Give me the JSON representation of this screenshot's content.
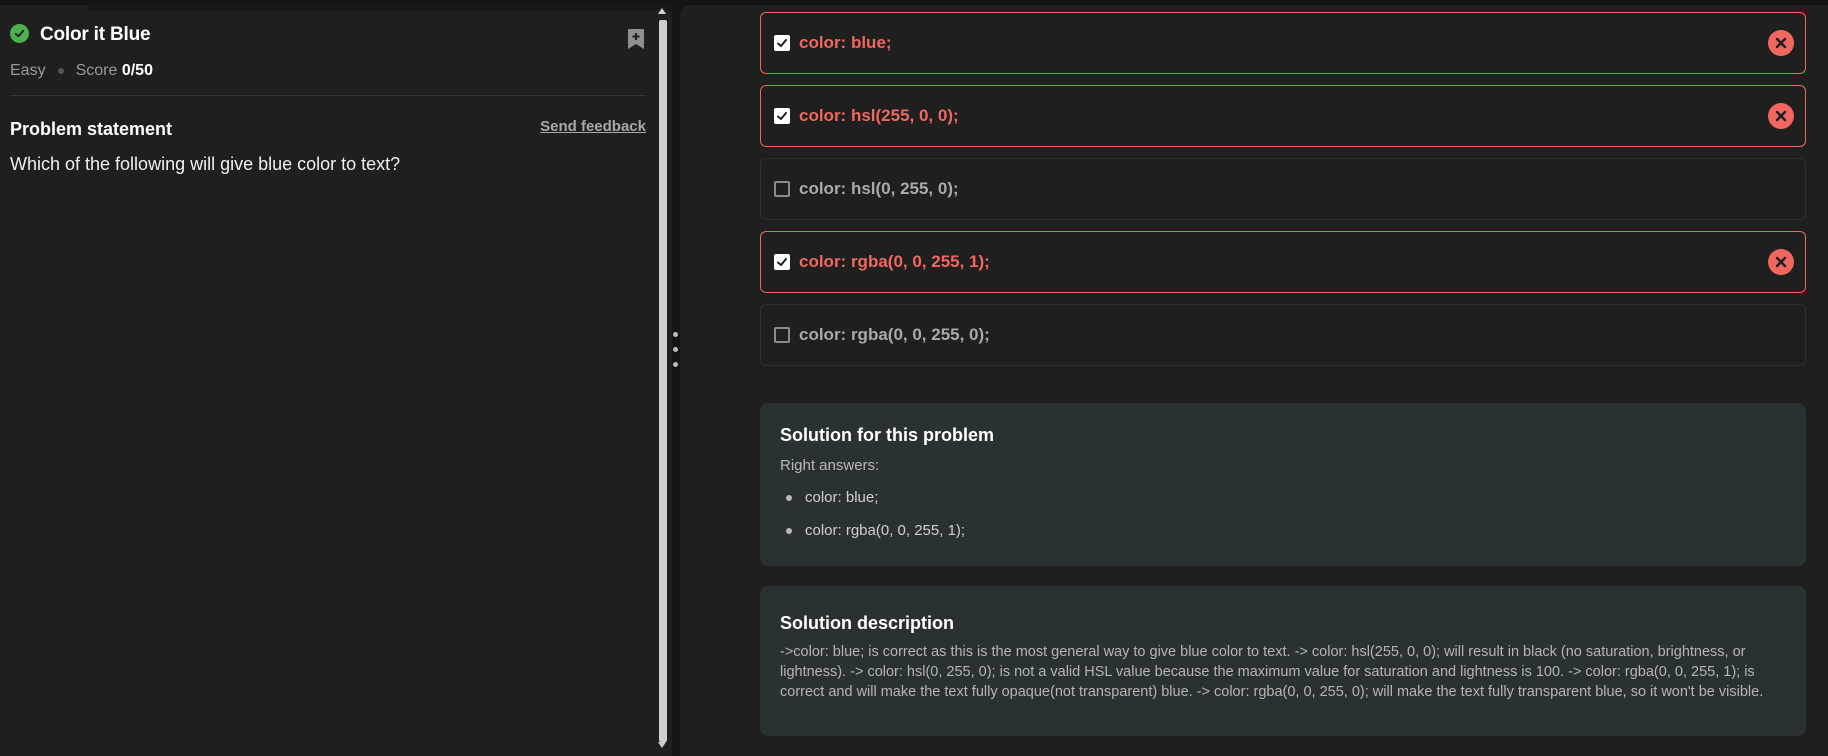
{
  "problem": {
    "title": "Color it Blue",
    "difficulty": "Easy",
    "score_label": "Score",
    "score_value": "0/50",
    "statement_heading": "Problem statement",
    "feedback_link": "Send feedback",
    "question": "Which of the following will give blue color to text?"
  },
  "options": [
    {
      "label": "color: blue;",
      "checked": true,
      "status": "wrong"
    },
    {
      "label": "color: hsl(255, 0, 0);",
      "checked": true,
      "status": "wrong"
    },
    {
      "label": "color: hsl(0, 255, 0);",
      "checked": false,
      "status": "neutral"
    },
    {
      "label": "color: rgba(0, 0, 255, 1);",
      "checked": true,
      "status": "wrong"
    },
    {
      "label": "color: rgba(0, 0, 255, 0);",
      "checked": false,
      "status": "neutral"
    }
  ],
  "solution": {
    "heading": "Solution for this problem",
    "right_answers_label": "Right answers:",
    "answers": [
      "color: blue;",
      "color: rgba(0, 0, 255, 1);"
    ]
  },
  "description": {
    "heading": "Solution description",
    "text": "->color: blue; is correct as this is the most general way to give blue color to text. -> color: hsl(255, 0, 0); will result in black (no saturation, brightness, or lightness). -> color: hsl(0, 255, 0); is not a valid HSL value because the maximum value for saturation and lightness is 100. -> color: rgba(0, 0, 255, 1); is correct and will make the text fully opaque(not transparent) blue. -> color: rgba(0, 0, 255, 0); will make the text fully transparent blue, so it won't be visible."
  },
  "colors": {
    "success": "#4caf50",
    "error": "#f0675f",
    "card_bg": "#2a3133",
    "panel_bg": "#1f1f1f"
  },
  "icons": {
    "status": "check-circle-icon",
    "bookmark": "bookmark-add-icon",
    "wrong": "close-circle-icon"
  }
}
